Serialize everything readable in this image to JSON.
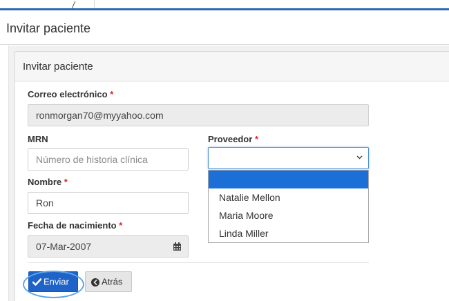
{
  "page": {
    "title": "Invitar paciente"
  },
  "panel": {
    "title": "Invitar paciente"
  },
  "form": {
    "email": {
      "label": "Correo electrónico",
      "required_mark": "*",
      "value": "ronmorgan70@myyahoo.com"
    },
    "mrn": {
      "label": "MRN",
      "placeholder": "Número de historia clínica"
    },
    "provider": {
      "label": "Proveedor",
      "required_mark": "*",
      "selected_value": "",
      "options": [
        "",
        "Natalie Mellon",
        "Maria Moore",
        "Linda Miller"
      ]
    },
    "first_name": {
      "label": "Nombre",
      "required_mark": "*",
      "value": "Ron"
    },
    "birth_date": {
      "label": "Fecha de nacimiento",
      "required_mark": "*",
      "value": "07-Mar-2007",
      "icon": "calendar-icon"
    }
  },
  "actions": {
    "submit": {
      "label": "Enviar",
      "icon": "check-icon"
    },
    "back": {
      "label": "Atrás",
      "icon": "circle-arrow-left-icon"
    }
  },
  "colors": {
    "primary": "#1f63c9",
    "header_rule": "#2b68b3",
    "required": "#d9232d",
    "dropdown_highlight": "#1b6fd6",
    "annotation": "#5ba6e6"
  }
}
